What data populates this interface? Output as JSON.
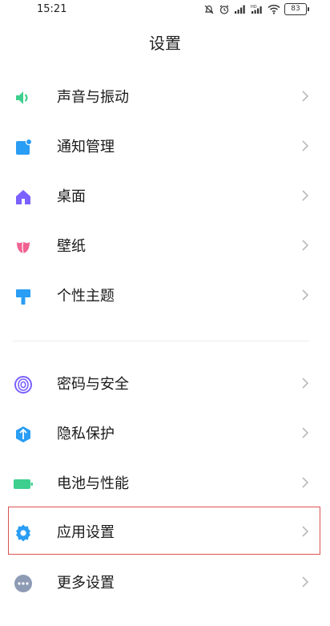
{
  "status_bar": {
    "time": "15:21",
    "battery": "83"
  },
  "header": {
    "title": "设置"
  },
  "group1": [
    {
      "label": "声音与振动",
      "icon": "speaker-icon",
      "color": "#3ecf8e"
    },
    {
      "label": "通知管理",
      "icon": "notification-icon",
      "color": "#2a9df4"
    },
    {
      "label": "桌面",
      "icon": "home-icon",
      "color": "#7b61ff"
    },
    {
      "label": "壁纸",
      "icon": "tulip-icon",
      "color": "#f06292"
    },
    {
      "label": "个性主题",
      "icon": "brush-icon",
      "color": "#2a9df4"
    }
  ],
  "group2": [
    {
      "label": "密码与安全",
      "icon": "fingerprint-icon",
      "color": "#7b61ff"
    },
    {
      "label": "隐私保护",
      "icon": "shield-icon",
      "color": "#2a9df4"
    },
    {
      "label": "电池与性能",
      "icon": "battery-icon",
      "color": "#3ecf8e"
    },
    {
      "label": "应用设置",
      "icon": "gear-icon",
      "color": "#2a9df4"
    },
    {
      "label": "更多设置",
      "icon": "more-icon",
      "color": "#8e9bb5"
    }
  ],
  "colors": {
    "chevron": "#b8b8b8",
    "highlight": "#d9534f"
  }
}
